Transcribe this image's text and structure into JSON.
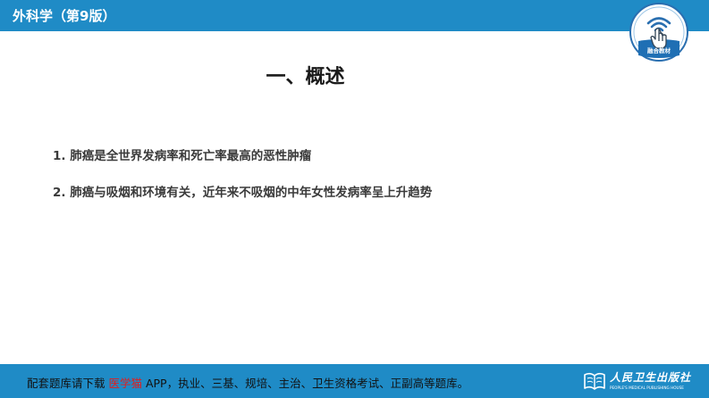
{
  "header": {
    "title": "外科学（第9版）",
    "badge_label": "融合教材",
    "badge_icon": "touch-wifi-icon"
  },
  "main": {
    "section_title": "一、概述",
    "bullets": [
      "1. 肺癌是全世界发病率和死亡率最高的恶性肿瘤",
      "2. 肺癌与吸烟和环境有关，近年来不吸烟的中年女性发病率呈上升趋势"
    ]
  },
  "footer": {
    "text_prefix": "配套题库请下载 ",
    "highlight": "医学猫",
    "text_suffix": " APP，执业、三基、规培、主治、卫生资格考试、正副高等题库。",
    "publisher_name": "人民卫生出版社",
    "publisher_english": "PEOPLE'S MEDICAL PUBLISHING HOUSE",
    "publisher_logo": "book-logo-icon"
  },
  "colors": {
    "bar": "#1f8bc6",
    "highlight": "#e01e1e",
    "title_text": "#1a1a1a",
    "body_text": "#3a3a3a"
  }
}
